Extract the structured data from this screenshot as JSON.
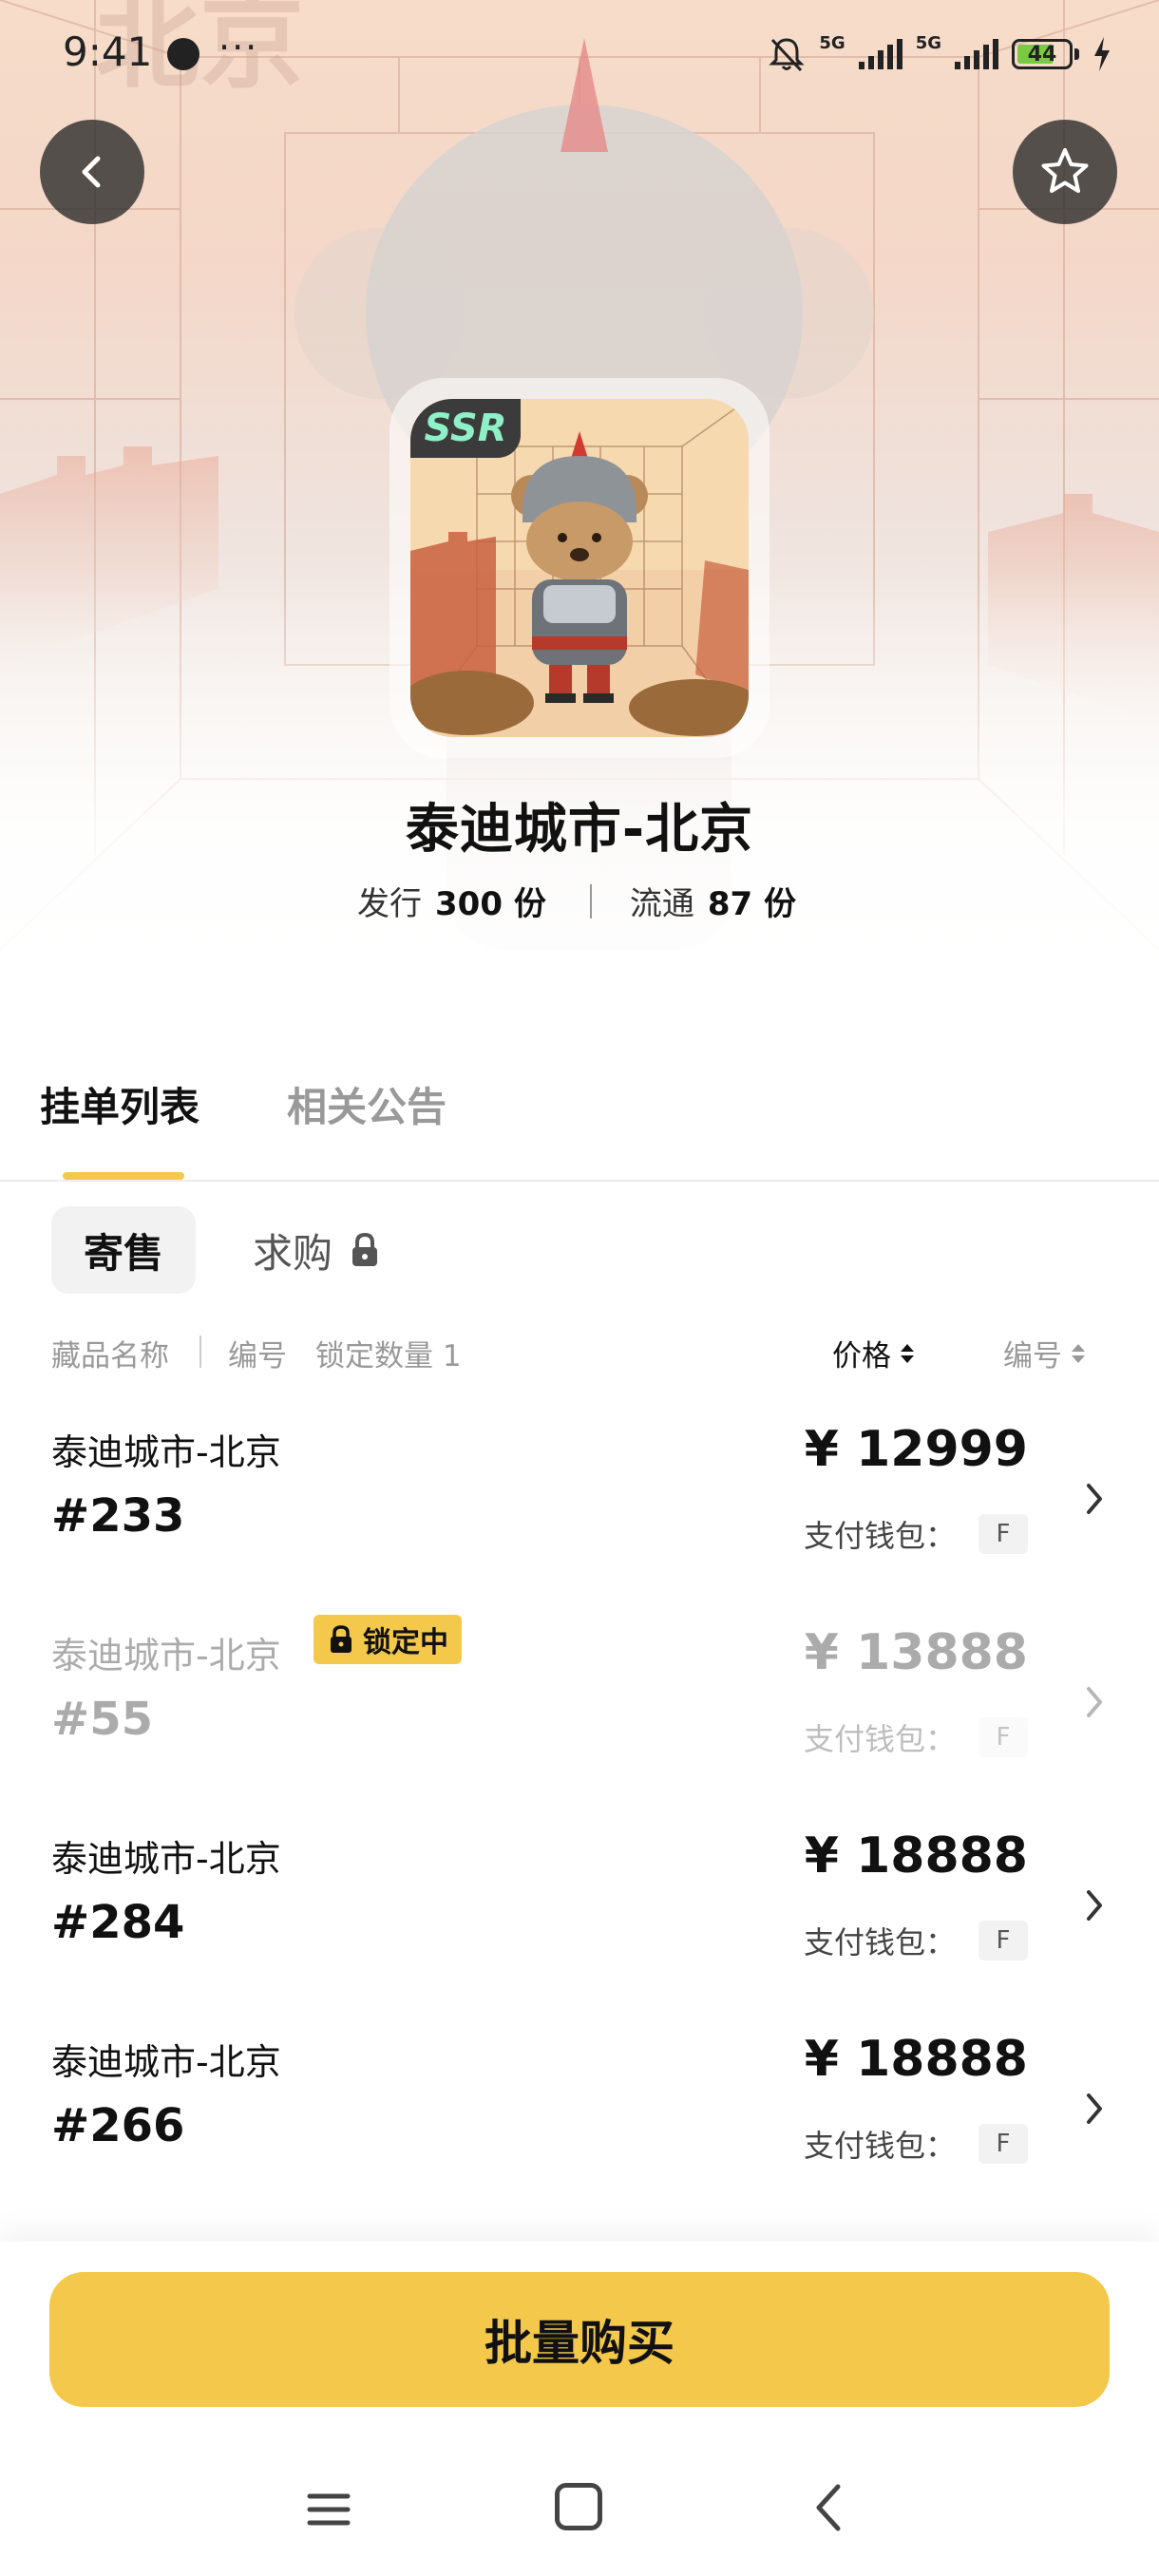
{
  "status_bar": {
    "time": "9:41",
    "dots": "···",
    "signal1": "5G",
    "signal2": "5G",
    "battery": "44"
  },
  "product": {
    "badge": "SSR",
    "title": "泰迪城市-北京",
    "issued_label": "发行",
    "issued_value": "300 份",
    "circulation_label": "流通",
    "circulation_value": "87 份"
  },
  "tabs": [
    {
      "label": "挂单列表",
      "active": true
    },
    {
      "label": "相关公告",
      "active": false
    }
  ],
  "subtabs": [
    {
      "label": "寄售",
      "active": true
    },
    {
      "label": "求购",
      "active": false
    }
  ],
  "table_header": {
    "name": "藏品名称",
    "number": "编号",
    "locked": "锁定数量 1",
    "price": "价格",
    "code": "编号"
  },
  "listings": [
    {
      "name": "泰迪城市-北京",
      "serial": "#233",
      "price": "¥ 12999",
      "wallet_label": "支付钱包：",
      "wallet": "F",
      "locked": false
    },
    {
      "name": "泰迪城市-北京",
      "serial": "#55",
      "price": "¥ 13888",
      "wallet_label": "支付钱包：",
      "wallet": "F",
      "locked": true,
      "lock_label": "锁定中"
    },
    {
      "name": "泰迪城市-北京",
      "serial": "#284",
      "price": "¥ 18888",
      "wallet_label": "支付钱包：",
      "wallet": "F",
      "locked": false
    },
    {
      "name": "泰迪城市-北京",
      "serial": "#266",
      "price": "¥ 18888",
      "wallet_label": "支付钱包：",
      "wallet": "F",
      "locked": false
    }
  ],
  "bottom": {
    "buy_label": "批量购买"
  },
  "colors": {
    "accent": "#f4c84a",
    "text": "#111111",
    "muted": "#999999"
  },
  "icons": [
    "back-icon",
    "star-icon",
    "lock-icon",
    "chevron-right-icon",
    "menu-icon",
    "home-icon",
    "nav-back-icon"
  ]
}
